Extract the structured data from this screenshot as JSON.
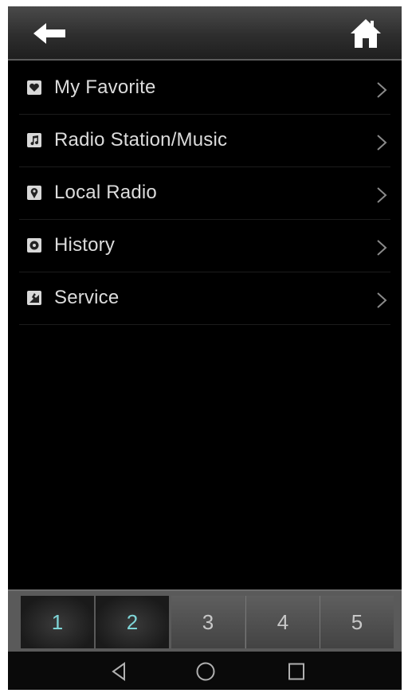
{
  "topbar": {
    "back_icon": "back-arrow-icon",
    "home_icon": "home-icon"
  },
  "menu": {
    "items": [
      {
        "label": "My Favorite",
        "icon": "favorite-icon"
      },
      {
        "label": "Radio Station/Music",
        "icon": "music-note-icon"
      },
      {
        "label": "Local Radio",
        "icon": "location-pin-icon"
      },
      {
        "label": "History",
        "icon": "history-icon"
      },
      {
        "label": "Service",
        "icon": "service-icon"
      }
    ]
  },
  "tabs": [
    {
      "label": "1",
      "active": true
    },
    {
      "label": "2",
      "active": true
    },
    {
      "label": "3",
      "active": false
    },
    {
      "label": "4",
      "active": false
    },
    {
      "label": "5",
      "active": false
    }
  ],
  "navbar": {
    "back": "nav-back-icon",
    "home": "nav-home-icon",
    "recents": "nav-recents-icon"
  },
  "colors": {
    "background": "#000000",
    "menu_text": "#dcdcdc",
    "active_tab_text": "#7fd6d8",
    "inactive_tab_text": "#c8c8c8"
  }
}
